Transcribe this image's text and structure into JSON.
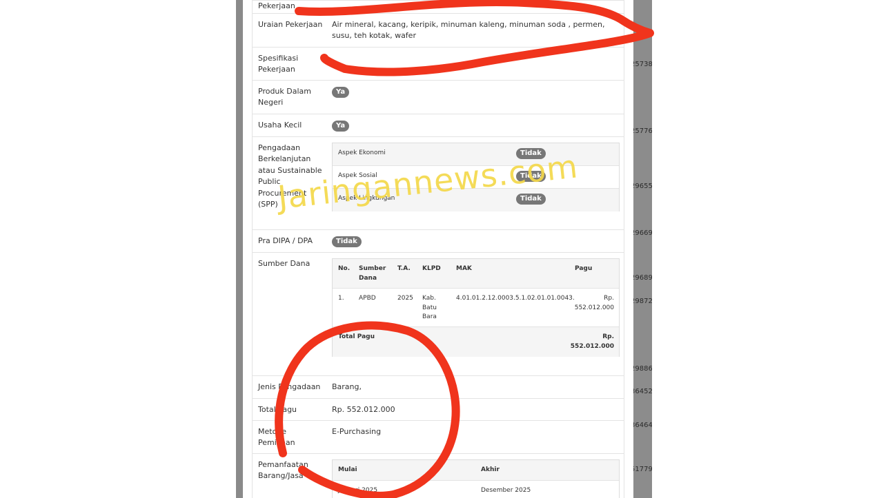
{
  "background": {
    "right_numbers": [
      "25738",
      "25776",
      "29655",
      "29669",
      "29689",
      "29872",
      "29886",
      "36452",
      "36464",
      "51779"
    ]
  },
  "rows": {
    "pekerjaan": {
      "label": "Pekerjaan"
    },
    "uraian": {
      "label": "Uraian Pekerjaan",
      "value": "Air mineral, kacang, keripik, minuman kaleng, minuman soda , permen, susu, teh kotak, wafer"
    },
    "spesifikasi": {
      "label": "Spesifikasi Pekerjaan",
      "value": ""
    },
    "pdn": {
      "label": "Produk Dalam Negeri",
      "badge": "Ya"
    },
    "usaha_kecil": {
      "label": "Usaha Kecil",
      "badge": "Ya"
    },
    "spp": {
      "label": "Pengadaan Berkelanjutan atau Sustainable Public Procurement (SPP)",
      "items": [
        {
          "aspect": "Aspek Ekonomi",
          "value": "Tidak"
        },
        {
          "aspect": "Aspek Sosial",
          "value": "Tidak"
        },
        {
          "aspect": "Aspek Lingkungan",
          "value": "Tidak"
        }
      ]
    },
    "pra_dipa": {
      "label": "Pra DIPA / DPA",
      "badge": "Tidak"
    },
    "sumber_dana": {
      "label": "Sumber Dana",
      "headers": {
        "no": "No.",
        "sumber": "Sumber Dana",
        "ta": "T.A.",
        "klpd": "KLPD",
        "mak": "MAK",
        "pagu": "Pagu"
      },
      "row": {
        "no": "1.",
        "sumber": "APBD",
        "ta": "2025",
        "klpd": "Kab. Batu Bara",
        "mak": "4.01.01.2.12.0003.5.1.02.01.01.0043.",
        "pagu": "Rp. 552.012.000"
      },
      "total_label": "Total Pagu",
      "total_value": "Rp. 552.012.000"
    },
    "jenis": {
      "label": "Jenis Pengadaan",
      "value": "Barang,"
    },
    "total_pagu": {
      "label": "Total Pagu",
      "value": "Rp. 552.012.000"
    },
    "metode": {
      "label": "Metode Pemilihan",
      "value": "E-Purchasing"
    },
    "pemanfaatan": {
      "label": "Pemanfaatan Barang/Jasa",
      "headers": {
        "mulai": "Mulai",
        "akhir": "Akhir"
      },
      "mulai": "Januari 2025",
      "akhir": "Desember 2025"
    }
  },
  "watermark": "Jaringannews.com",
  "colors": {
    "annotation_red": "#f0341c",
    "watermark": "#f4d84a",
    "badge": "#777777"
  }
}
